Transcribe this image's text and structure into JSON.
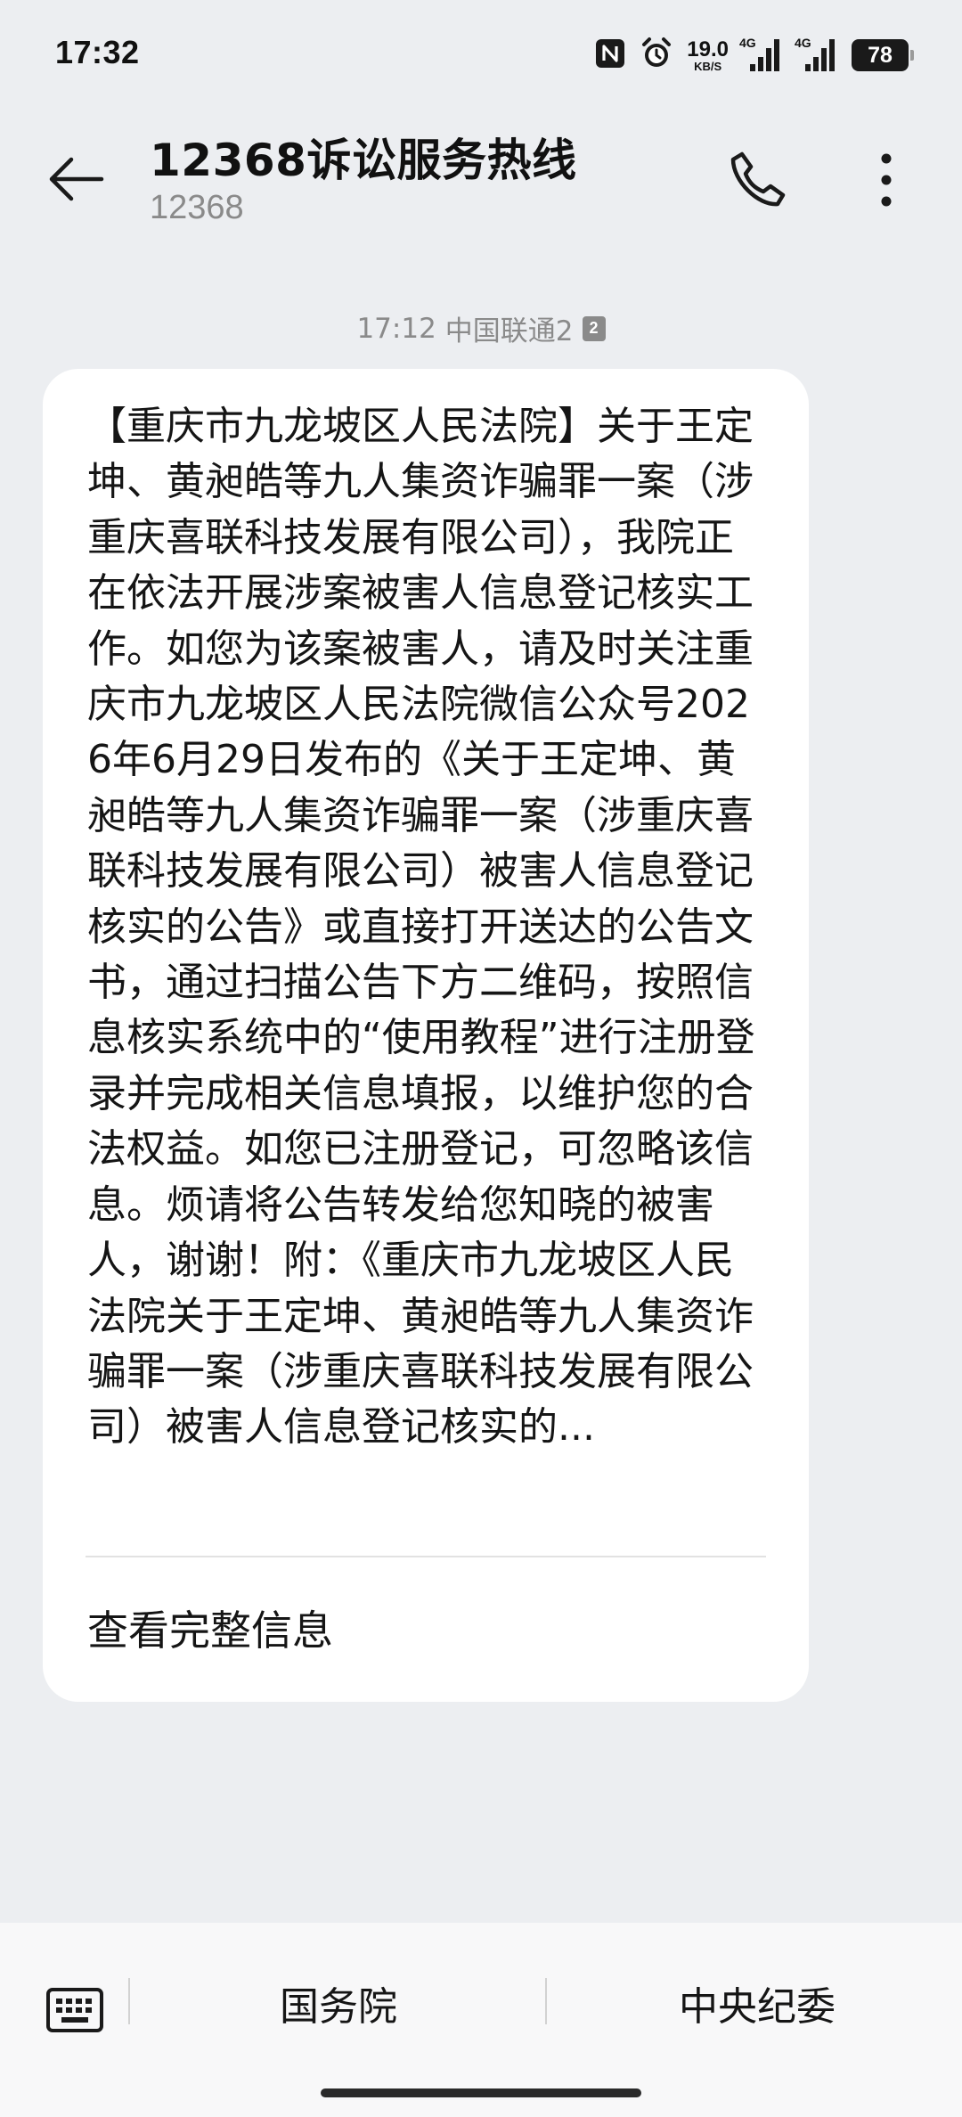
{
  "status_bar": {
    "time": "17:32",
    "net_speed": "19.0",
    "net_speed_unit": "KB/S",
    "network_1": "4G",
    "network_2": "4G",
    "battery": "78"
  },
  "header": {
    "contact_name": "12368诉讼服务热线",
    "contact_number": "12368",
    "icons": [
      "back-arrow",
      "phone",
      "more-vertical"
    ]
  },
  "message": {
    "time": "17:12",
    "carrier": "中国联通2",
    "sim": "2",
    "body": "【重庆市九龙坡区人民法院】关于王定坤、黄昶皓等九人集资诈骗罪一案（涉重庆喜联科技发展有限公司），我院正在依法开展涉案被害人信息登记核实工作。如您为该案被害人，请及时关注重庆市九龙坡区人民法院微信公众号2026年6月29日发布的《关于王定坤、黄昶皓等九人集资诈骗罪一案（涉重庆喜联科技发展有限公司）被害人信息登记核实的公告》或直接打开送达的公告文书，通过扫描公告下方二维码，按照信息核实系统中的“使用教程”进行注册登录并完成相关信息填报，以维护您的合法权益。如您已注册登记，可忽略该信息。烦请将公告转发给您知晓的被害人，谢谢！附：《重庆市九龙坡区人民法院关于王定坤、黄昶皓等九人集资诈骗罪一案（涉重庆喜联科技发展有限公司）被害人信息登记核实的...",
    "view_full": "查看完整信息"
  },
  "quick_replies": {
    "keyboard_icon": "keyboard",
    "reply_1": "国务院",
    "reply_2": "中央纪委"
  }
}
